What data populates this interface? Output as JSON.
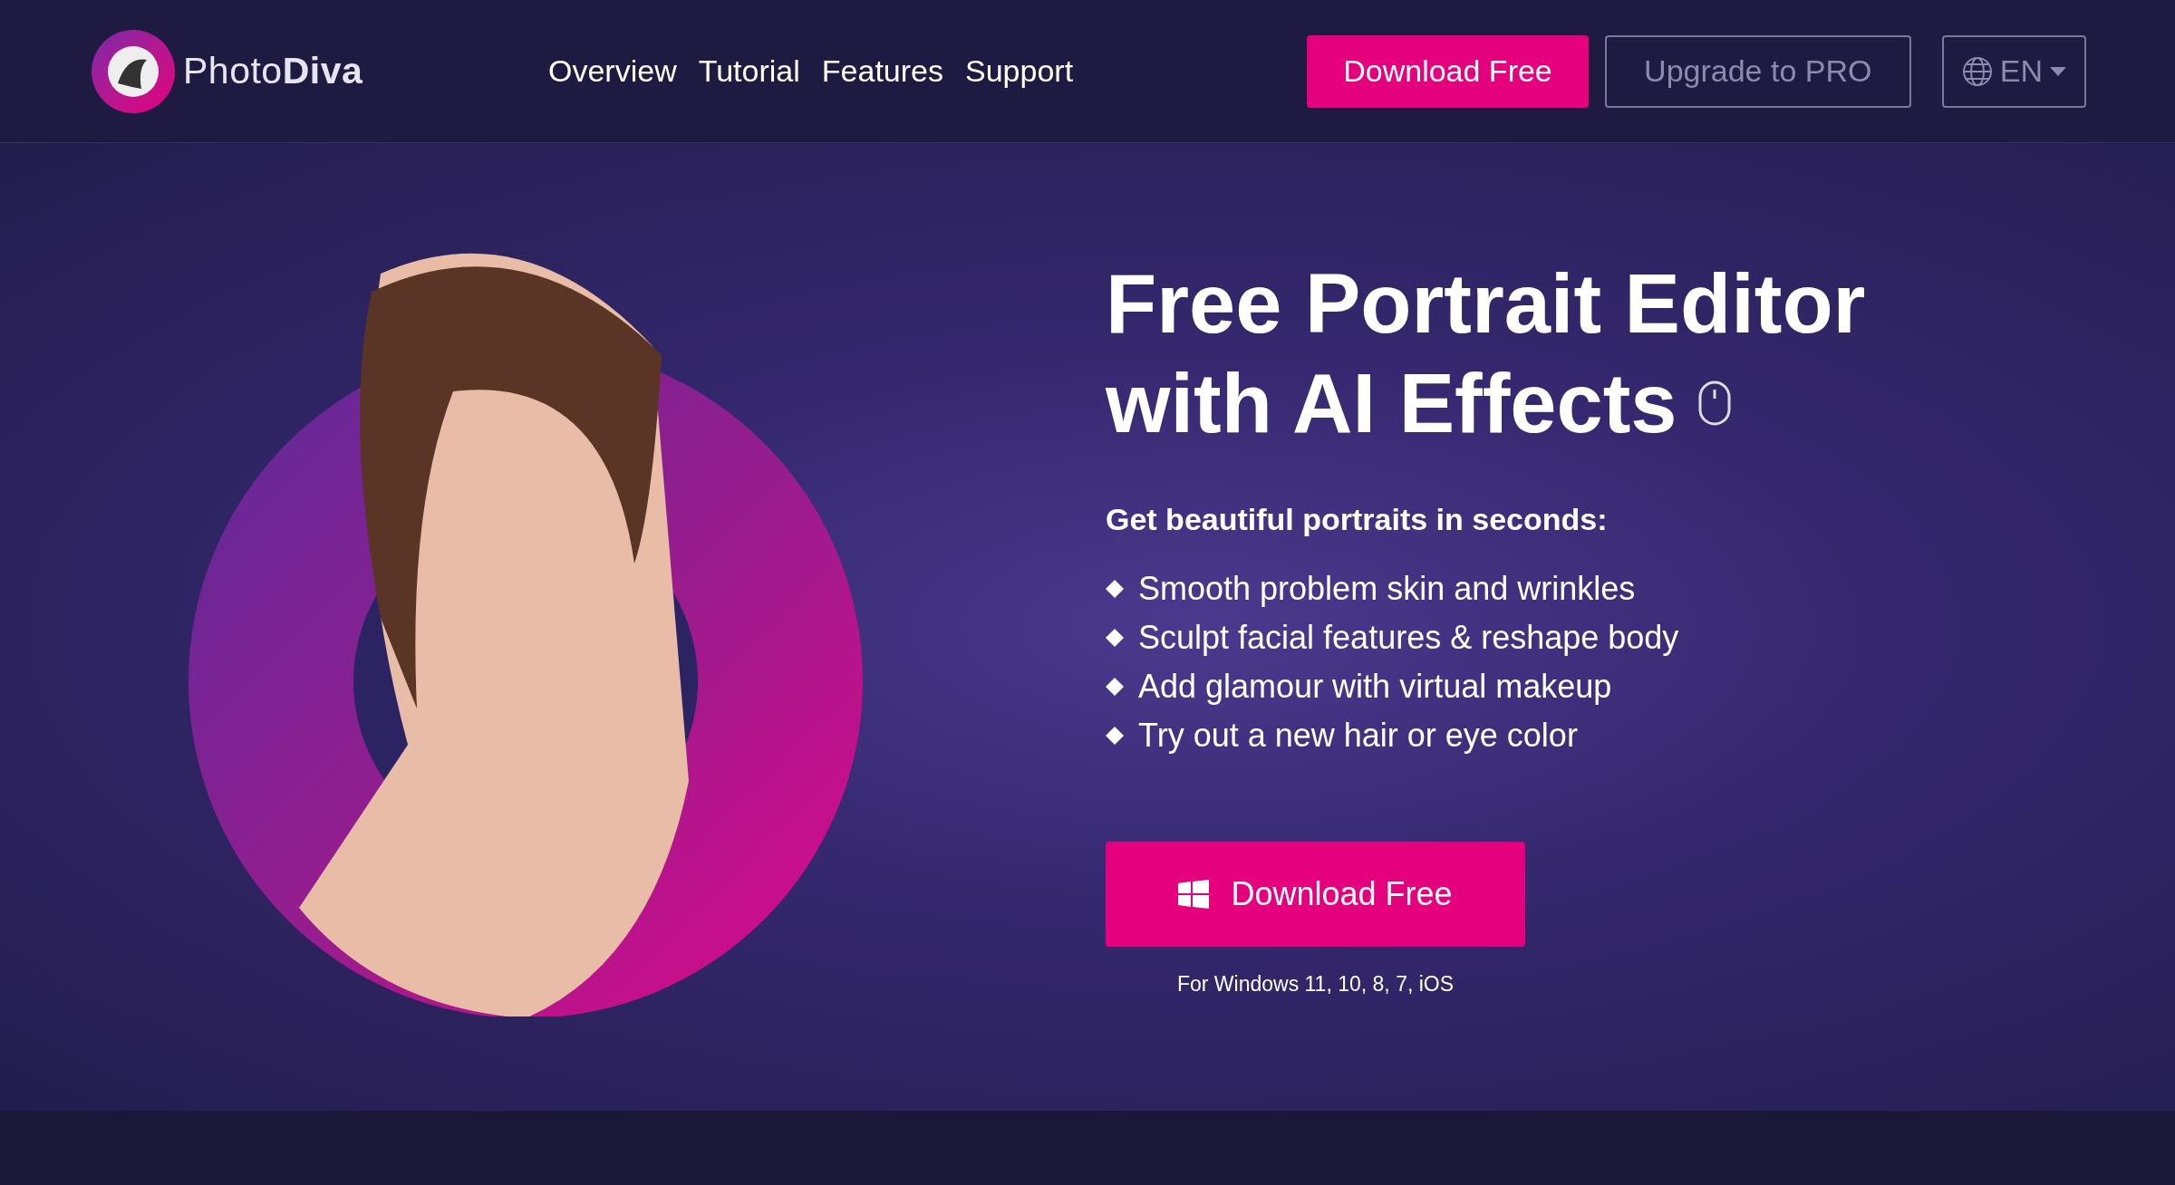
{
  "header": {
    "logo": "Photo**Diva**",
    "nav": [
      {
        "label": "Overview"
      },
      {
        "label": "Tutorial"
      },
      {
        "label": "Features"
      },
      {
        "label": "Support"
      }
    ],
    "download_button": "Download Free",
    "upgrade_button": "Upgrade to PRO",
    "language": "EN"
  },
  "hero": {
    "title_lines": [
      "Free Portrait Editor",
      "with AI Effects"
    ],
    "subtitle": "Get beautiful portraits in seconds:",
    "bullets": [
      "Smooth problem skin and wrinkles",
      "Sculpt facial features & reshape body",
      "Add glamour with virtual makeup",
      "Try out a new hair or eye color"
    ],
    "cta": "Download Free",
    "platforms": "For Windows 11, 10, 8, 7, iOS"
  }
}
